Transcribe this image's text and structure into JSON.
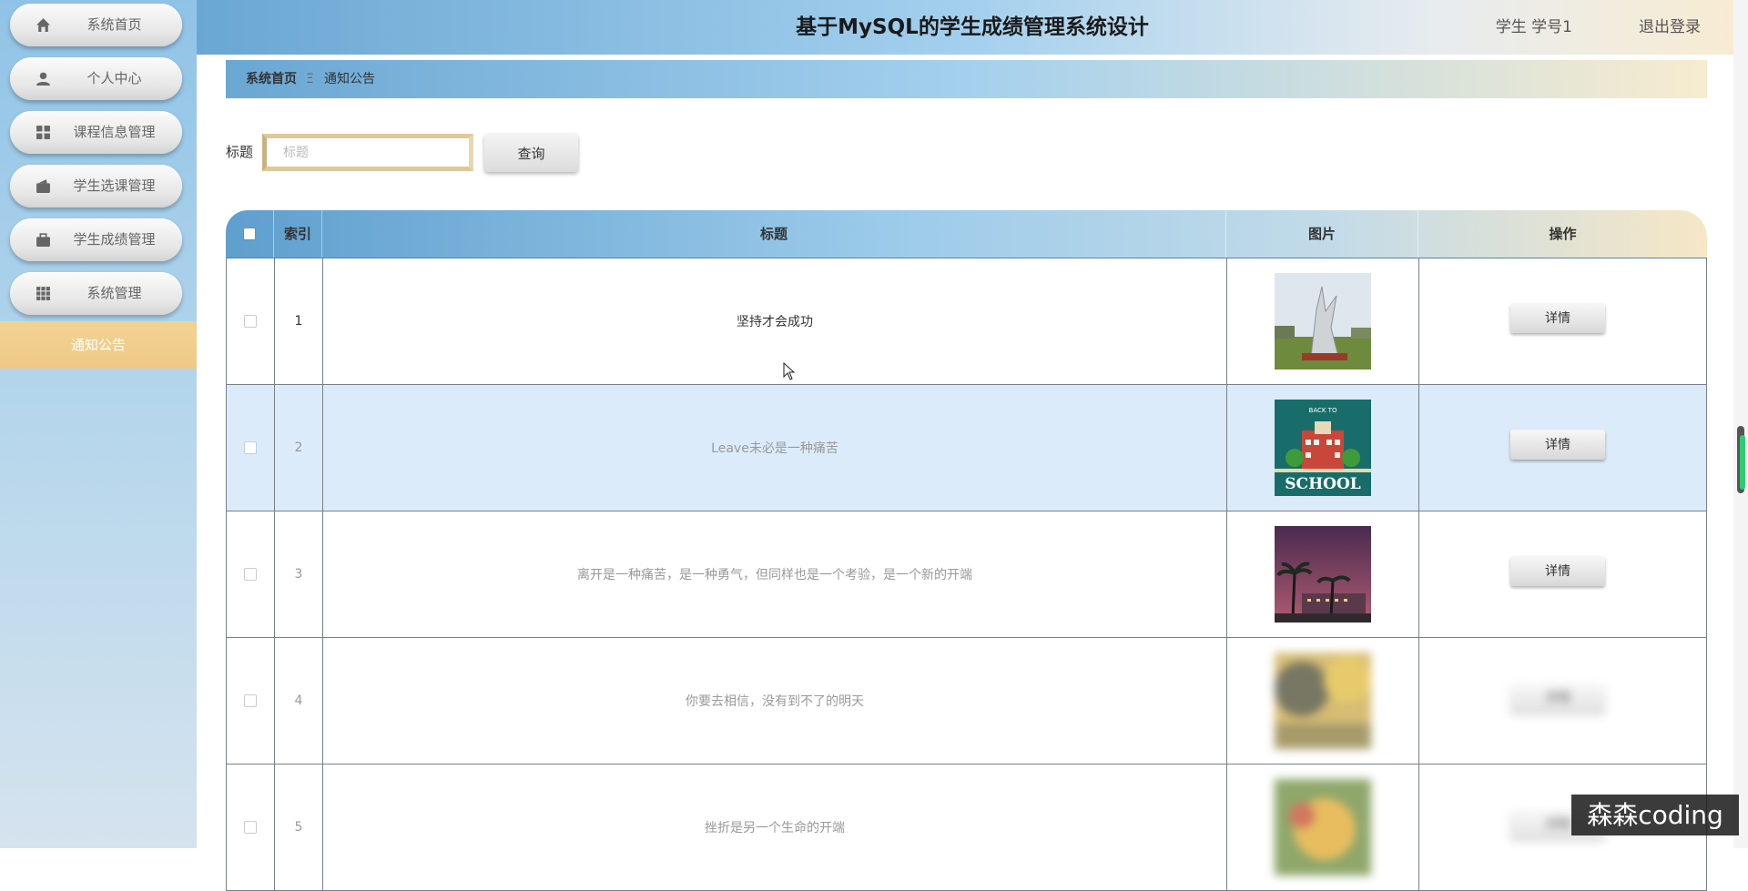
{
  "header": {
    "title": "基于MySQL的学生成绩管理系统设计",
    "user": "学生 学号1",
    "logout": "退出登录"
  },
  "sidebar": {
    "items": [
      {
        "label": "系统首页",
        "icon": "home-icon"
      },
      {
        "label": "个人中心",
        "icon": "user-icon"
      },
      {
        "label": "课程信息管理",
        "icon": "grid-icon"
      },
      {
        "label": "学生选课管理",
        "icon": "wallet-icon"
      },
      {
        "label": "学生成绩管理",
        "icon": "briefcase-icon"
      },
      {
        "label": "系统管理",
        "icon": "apps-icon"
      }
    ],
    "active": "通知公告"
  },
  "breadcrumb": {
    "home": "系统首页",
    "separator": "Ξ",
    "current": "通知公告"
  },
  "search": {
    "label": "标题",
    "placeholder": "标题",
    "value": "",
    "button": "查询"
  },
  "table": {
    "columns": [
      "索引",
      "标题",
      "图片",
      "操作"
    ],
    "rows": [
      {
        "index": "1",
        "title": "坚持才会成功",
        "action": "详情"
      },
      {
        "index": "2",
        "title": "Leave未必是一种痛苦",
        "action": "详情"
      },
      {
        "index": "3",
        "title": "离开是一种痛苦，是一种勇气，但同样也是一个考验，是一个新的开端",
        "action": "详情"
      },
      {
        "index": "4",
        "title": "你要去相信，没有到不了的明天",
        "action": "详情"
      },
      {
        "index": "5",
        "title": "挫折是另一个生命的开端",
        "action": "详情"
      }
    ],
    "thumb_school_text": "SCHOOL",
    "thumb_school_sub": "BACK TO"
  },
  "watermark": "森森coding",
  "colors": {
    "accent_blue": "#6aa7d3",
    "accent_gold": "#f0c984",
    "highlight_row": "#dcebfa"
  }
}
